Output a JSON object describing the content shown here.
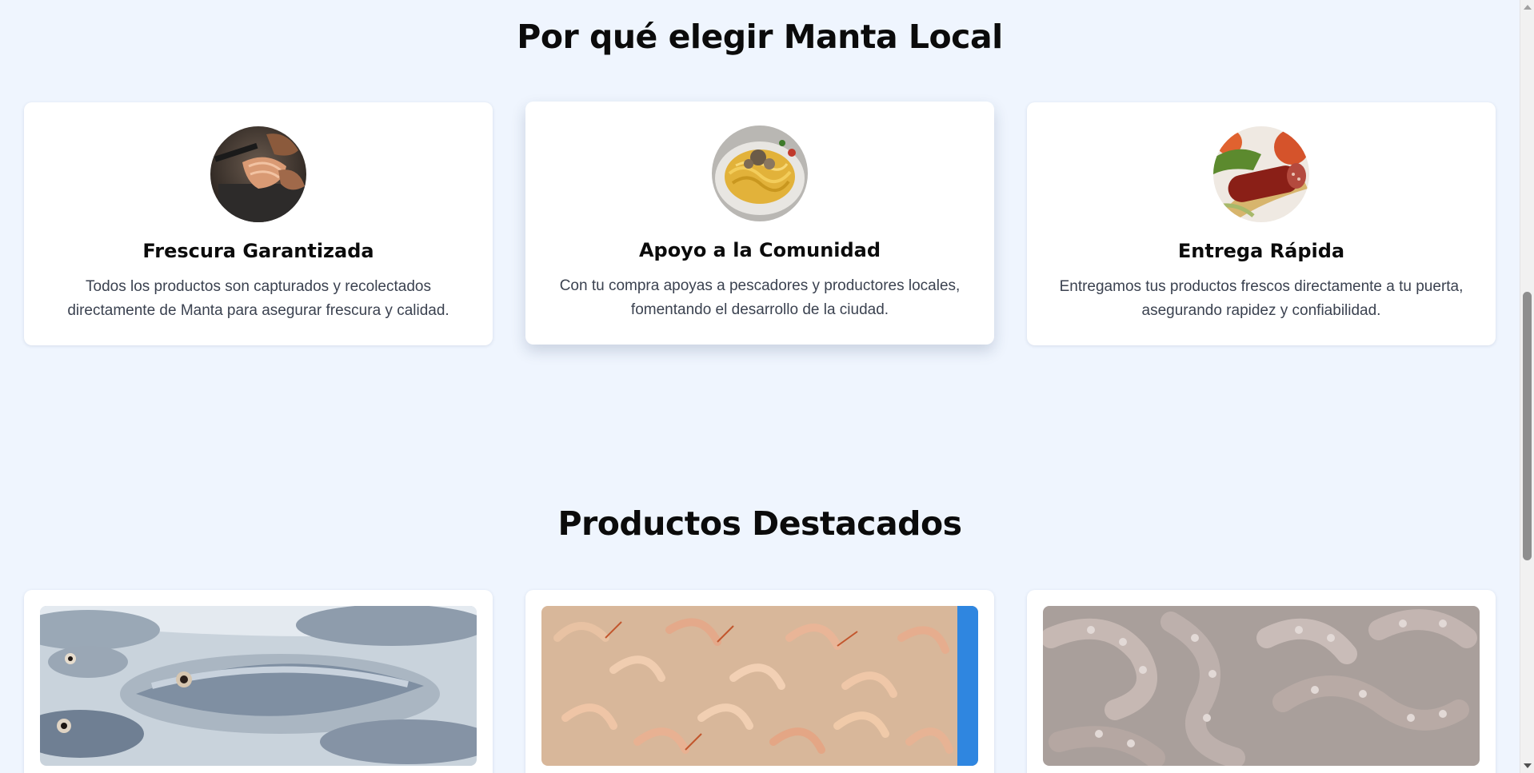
{
  "why_section": {
    "title": "Por qué elegir Manta Local",
    "features": [
      {
        "title": "Frescura Garantizada",
        "description": "Todos los productos son capturados y recolectados directamente de Manta para asegurar frescura y calidad.",
        "image_icon": "fish-fillet-photo"
      },
      {
        "title": "Apoyo a la Comunidad",
        "description": "Con tu compra apoyas a pescadores y productores locales, fomentando el desarrollo de la ciudad.",
        "image_icon": "pasta-dish-photo"
      },
      {
        "title": "Entrega Rápida",
        "description": "Entregamos tus productos frescos directamente a tu puerta, asegurando rapidez y confiabilidad.",
        "image_icon": "sausage-photo"
      }
    ]
  },
  "products_section": {
    "title": "Productos Destacados",
    "products": [
      {
        "image_icon": "fresh-fish-on-ice-photo"
      },
      {
        "image_icon": "shrimp-photo"
      },
      {
        "image_icon": "octopus-photo"
      }
    ]
  },
  "colors": {
    "page_background": "#eff5fe",
    "card_background": "#ffffff",
    "heading_text": "#0b0b0b",
    "body_text": "#3b4250"
  }
}
